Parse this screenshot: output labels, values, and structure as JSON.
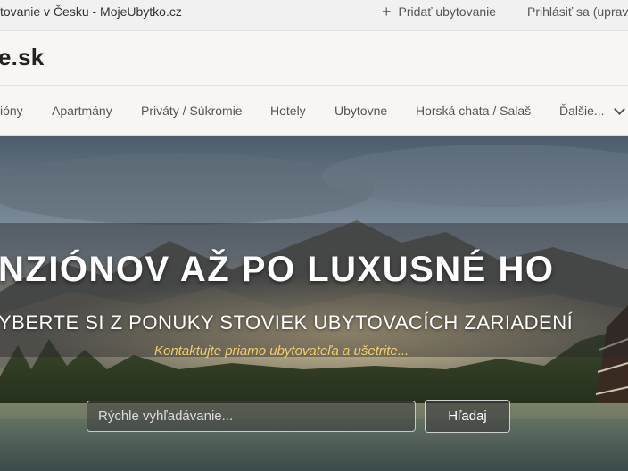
{
  "topbar": {
    "crosslink": "tovanie v Česku - MojeUbytko.cz",
    "add_label": "Pridať ubytovanie",
    "login_label": "Prihlásiť sa (uprav"
  },
  "header": {
    "logo": "e.sk"
  },
  "nav": {
    "items": [
      "ióny",
      "Apartmány",
      "Priváty / Súkromie",
      "Hotely",
      "Ubytovne",
      "Horská chata / Salaš",
      "Ďalšie..."
    ]
  },
  "hero": {
    "headline": "NZIÓNOV AŽ PO LUXUSNÉ HO",
    "subhead": "YBERTE SI Z PONUKY STOVIEK UBYTOVACÍCH ZARIADENÍ",
    "tagline": "Kontaktujte priamo ubytovateľa a ušetrite...",
    "search_placeholder": "Rýchle vyhľadávanie...",
    "search_button": "Hľadaj"
  },
  "icons": {
    "add": "plus-icon",
    "more": "chevron-down-icon"
  }
}
